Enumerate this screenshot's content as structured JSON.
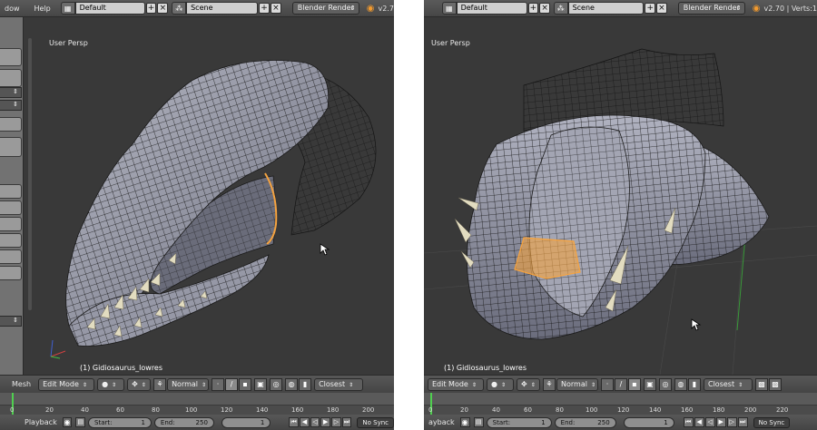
{
  "left": {
    "menu": [
      "dow",
      "Help"
    ],
    "layout": "Default",
    "scene": "Scene",
    "render_engine": "Blender Render",
    "version": "v2.7",
    "view_label": "User Persp",
    "object_label": "(1) Gidiosaurus_lowres",
    "bottom": {
      "mesh_menu": "Mesh",
      "mode": "Edit Mode",
      "pivot": "Normal",
      "snap": "Closest"
    },
    "timeline_ticks": [
      "0",
      "20",
      "40",
      "60",
      "80",
      "100",
      "120",
      "140",
      "160",
      "180",
      "200"
    ],
    "play": {
      "label": "Playback",
      "start_label": "Start:",
      "start": "1",
      "end_label": "End:",
      "end": "250",
      "current": "1",
      "sync": "No Sync"
    }
  },
  "right": {
    "layout": "Default",
    "scene": "Scene",
    "render_engine": "Blender Render",
    "version": "v2.70 | Verts:1",
    "view_label": "User Persp",
    "object_label": "(1) Gidiosaurus_lowres",
    "bottom": {
      "mode": "Edit Mode",
      "pivot": "Normal",
      "snap": "Closest"
    },
    "timeline_ticks": [
      "0",
      "20",
      "40",
      "60",
      "80",
      "100",
      "120",
      "140",
      "160",
      "180",
      "200",
      "220"
    ],
    "play": {
      "label": "ayback",
      "start_label": "Start:",
      "start": "1",
      "end_label": "End:",
      "end": "250",
      "current": "1",
      "sync": "No Sync"
    }
  },
  "colors": {
    "viewport_bg": "#393939",
    "mesh_face": "#8d8f9c",
    "mesh_wire": "#111111",
    "selection": "#f5a340",
    "teeth": "#e2dcc0",
    "frame_marker": "#4fcf4f"
  },
  "icons": [
    "blender-logo-icon",
    "layout-icon",
    "scene-icon",
    "mouse-cursor-icon",
    "axis-gizmo-icon"
  ]
}
